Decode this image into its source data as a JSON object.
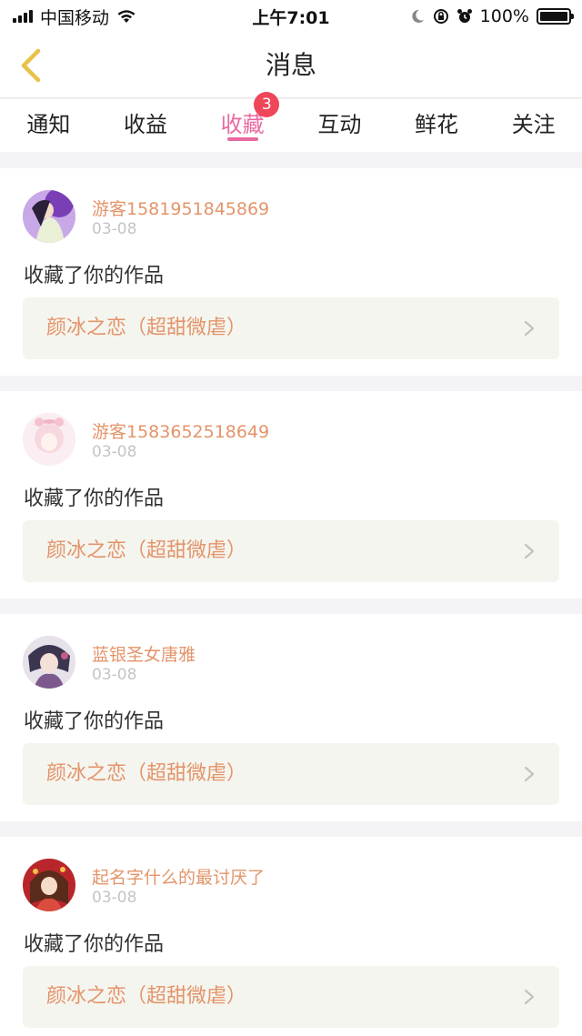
{
  "status_bar": {
    "carrier": "中国移动",
    "time": "上午7:01",
    "battery": "100%"
  },
  "header": {
    "title": "消息",
    "back_icon": "chevron-left-icon"
  },
  "tabs": [
    {
      "label": "通知"
    },
    {
      "label": "收益"
    },
    {
      "label": "收藏",
      "badge": "3",
      "active": true
    },
    {
      "label": "互动"
    },
    {
      "label": "鲜花"
    },
    {
      "label": "关注"
    }
  ],
  "messages": [
    {
      "username": "游客1581951845869",
      "date": "03-08",
      "action": "收藏了你的作品",
      "work_title": "颜冰之恋（超甜微虐）"
    },
    {
      "username": "游客1583652518649",
      "date": "03-08",
      "action": "收藏了你的作品",
      "work_title": "颜冰之恋（超甜微虐）"
    },
    {
      "username": "蓝银圣女唐雅",
      "date": "03-08",
      "action": "收藏了你的作品",
      "work_title": "颜冰之恋（超甜微虐）"
    },
    {
      "username": "起名字什么的最讨厌了",
      "date": "03-08",
      "action": "收藏了你的作品",
      "work_title": "颜冰之恋（超甜微虐）"
    }
  ],
  "colors": {
    "accent": "#e86aa0",
    "username": "#e3946a",
    "badge": "#f0465a",
    "back_arrow": "#e8c24a"
  }
}
